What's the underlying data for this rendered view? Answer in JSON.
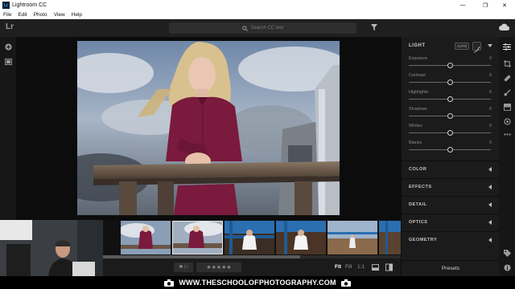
{
  "window": {
    "title": "Lightroom CC",
    "app_badge": "Lr",
    "controls": [
      "—",
      "❐",
      "✕"
    ]
  },
  "menu": {
    "items": [
      "File",
      "Edit",
      "Photo",
      "View",
      "Help"
    ]
  },
  "topbar": {
    "logo": "Lr",
    "search_placeholder": "Search CC test",
    "icons": [
      "search-icon",
      "filter-icon",
      "cloud-icon"
    ]
  },
  "light_panel": {
    "title": "LIGHT",
    "auto_label": "AUTO",
    "sliders": [
      {
        "label": "Exposure",
        "value": "0",
        "level": 0.5
      },
      {
        "label": "Contrast",
        "value": "0",
        "level": 0.5
      },
      {
        "label": "Highlights",
        "value": "0",
        "level": 0.5
      },
      {
        "label": "Shadows",
        "value": "0",
        "level": 0.5
      },
      {
        "label": "Whites",
        "value": "0",
        "level": 0.5
      },
      {
        "label": "Blacks",
        "value": "0",
        "level": 0.5
      }
    ]
  },
  "sections": [
    {
      "label": "COLOR"
    },
    {
      "label": "EFFECTS"
    },
    {
      "label": "DETAIL"
    },
    {
      "label": "OPTICS"
    },
    {
      "label": "GEOMETRY"
    }
  ],
  "presets_label": "Presets",
  "toolbar": {
    "flags": "⚑⚐",
    "stars": "★★★★★",
    "fit": "Fit",
    "fill": "Fill",
    "one_to_one": "1:1"
  },
  "watermark": {
    "text": "WWW.THESCHOOLOFPHOTOGRAPHY.COM"
  },
  "colors": {
    "panel_bg": "#1b1b1b",
    "canvas_bg": "#0c0c0c",
    "dress": "#7a1a3c",
    "accent": "#31a8ff"
  }
}
